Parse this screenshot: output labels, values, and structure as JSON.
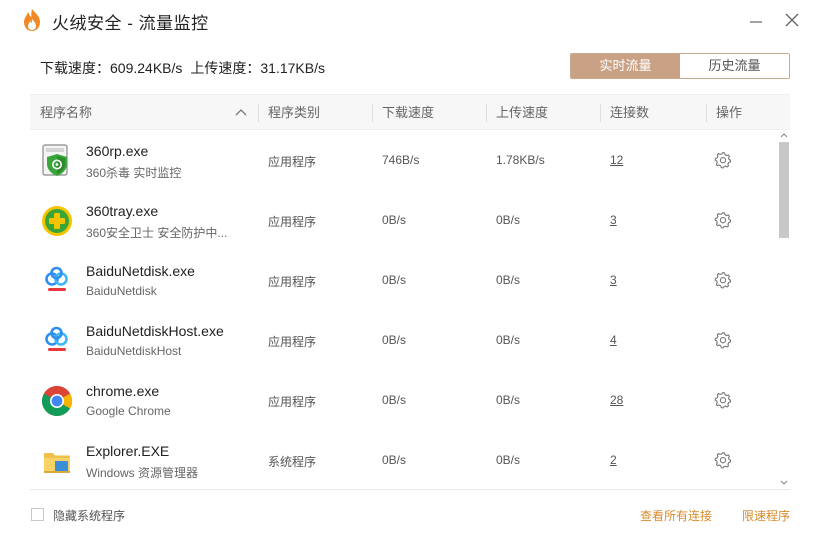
{
  "window": {
    "title": "火绒安全 - 流量监控",
    "logo_icon": "huorong-flame-icon",
    "minimize_icon": "minimize-icon",
    "close_icon": "close-icon"
  },
  "summary": {
    "download_label": "下载速度：",
    "download_value": "609.24KB/s",
    "upload_label": "上传速度：",
    "upload_value": "31.17KB/s"
  },
  "toggle": {
    "realtime_label": "实时流量",
    "history_label": "历史流量",
    "active": "realtime",
    "accent_color": "#c9a285"
  },
  "table": {
    "columns": [
      "程序名称",
      "程序类别",
      "下载速度",
      "上传速度",
      "连接数",
      "操作"
    ],
    "rows": [
      {
        "name": "360rp.exe",
        "desc": "360杀毒 实时监控",
        "category": "应用程序",
        "download": "746B/s",
        "upload": "1.78KB/s",
        "connections": "12",
        "icon": "360-antivirus-shield-icon"
      },
      {
        "name": "360tray.exe",
        "desc": "360安全卫士 安全防护中...",
        "category": "应用程序",
        "download": "0B/s",
        "upload": "0B/s",
        "connections": "3",
        "icon": "360-safeguard-icon"
      },
      {
        "name": "BaiduNetdisk.exe",
        "desc": "BaiduNetdisk",
        "category": "应用程序",
        "download": "0B/s",
        "upload": "0B/s",
        "connections": "3",
        "icon": "baidu-netdisk-icon"
      },
      {
        "name": "BaiduNetdiskHost.exe",
        "desc": "BaiduNetdiskHost",
        "category": "应用程序",
        "download": "0B/s",
        "upload": "0B/s",
        "connections": "4",
        "icon": "baidu-netdisk-icon"
      },
      {
        "name": "chrome.exe",
        "desc": "Google Chrome",
        "category": "应用程序",
        "download": "0B/s",
        "upload": "0B/s",
        "connections": "28",
        "icon": "chrome-icon"
      },
      {
        "name": "Explorer.EXE",
        "desc": "Windows 资源管理器",
        "category": "系统程序",
        "download": "0B/s",
        "upload": "0B/s",
        "connections": "2",
        "icon": "folder-explorer-icon"
      }
    ]
  },
  "footer": {
    "hide_system_label": "隐藏系统程序",
    "view_all_label": "查看所有连接",
    "limit_speed_label": "限速程序",
    "link_color": "#d98b2b"
  }
}
